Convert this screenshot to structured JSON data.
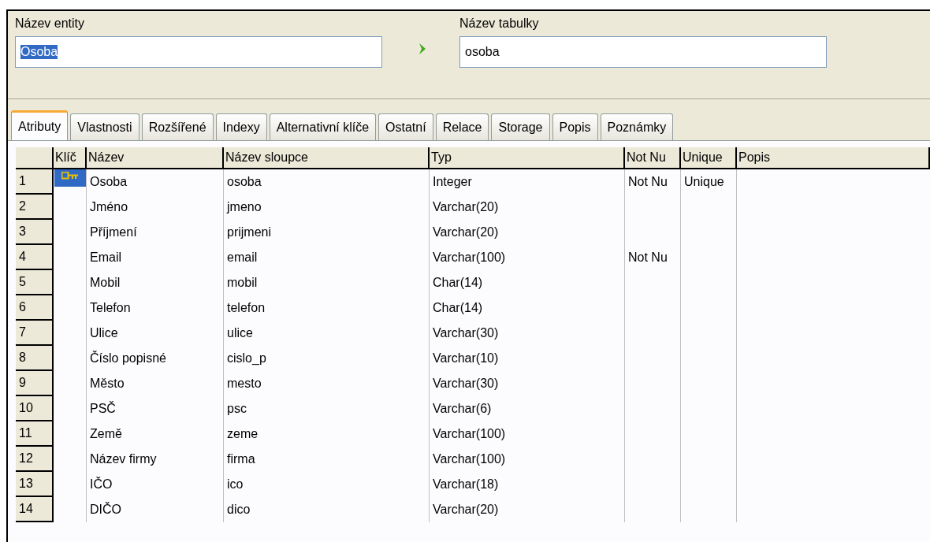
{
  "entity_name": {
    "label": "Název entity",
    "value": "Osoba",
    "text_selected": true
  },
  "table_name": {
    "label": "Název tabulky",
    "value": "osoba"
  },
  "tabs": [
    {
      "label": "Atributy",
      "selected": true
    },
    {
      "label": "Vlastnosti",
      "selected": false
    },
    {
      "label": "Rozšířené",
      "selected": false
    },
    {
      "label": "Indexy",
      "selected": false
    },
    {
      "label": "Alternativní klíče",
      "selected": false
    },
    {
      "label": "Ostatní",
      "selected": false
    },
    {
      "label": "Relace",
      "selected": false
    },
    {
      "label": "Storage",
      "selected": false
    },
    {
      "label": "Popis",
      "selected": false
    },
    {
      "label": "Poznámky",
      "selected": false
    }
  ],
  "grid": {
    "columns": [
      "Klíč",
      "Název",
      "Název sloupce",
      "Typ",
      "Not Nu",
      "Unique",
      "Popis"
    ],
    "rows": [
      {
        "number": "1",
        "primary_key": true,
        "name": "Osoba",
        "column_name": "osoba",
        "type": "Integer",
        "not_null": "Not Nu",
        "unique": "Unique"
      },
      {
        "number": "2",
        "primary_key": false,
        "name": "Jméno",
        "column_name": "jmeno",
        "type": "Varchar(20)"
      },
      {
        "number": "3",
        "primary_key": false,
        "name": "Příjmení",
        "column_name": "prijmeni",
        "type": "Varchar(20)"
      },
      {
        "number": "4",
        "primary_key": false,
        "name": "Email",
        "column_name": "email",
        "type": "Varchar(100)",
        "not_null": "Not Nu"
      },
      {
        "number": "5",
        "primary_key": false,
        "name": "Mobil",
        "column_name": "mobil",
        "type": "Char(14)"
      },
      {
        "number": "6",
        "primary_key": false,
        "name": "Telefon",
        "column_name": "telefon",
        "type": "Char(14)"
      },
      {
        "number": "7",
        "primary_key": false,
        "name": "Ulice",
        "column_name": "ulice",
        "type": "Varchar(30)"
      },
      {
        "number": "8",
        "primary_key": false,
        "name": "Číslo popisné",
        "column_name": "cislo_p",
        "type": "Varchar(10)"
      },
      {
        "number": "9",
        "primary_key": false,
        "name": "Město",
        "column_name": "mesto",
        "type": "Varchar(30)"
      },
      {
        "number": "10",
        "primary_key": false,
        "name": "PSČ",
        "column_name": "psc",
        "type": "Varchar(6)"
      },
      {
        "number": "11",
        "primary_key": false,
        "name": "Země",
        "column_name": "zeme",
        "type": "Varchar(100)"
      },
      {
        "number": "12",
        "primary_key": false,
        "name": "Název firmy",
        "column_name": "firma",
        "type": "Varchar(100)"
      },
      {
        "number": "13",
        "primary_key": false,
        "name": "IČO",
        "column_name": "ico",
        "type": "Varchar(18)"
      },
      {
        "number": "14",
        "primary_key": false,
        "name": "DIČO",
        "column_name": "dico",
        "type": "Varchar(20)"
      }
    ]
  }
}
